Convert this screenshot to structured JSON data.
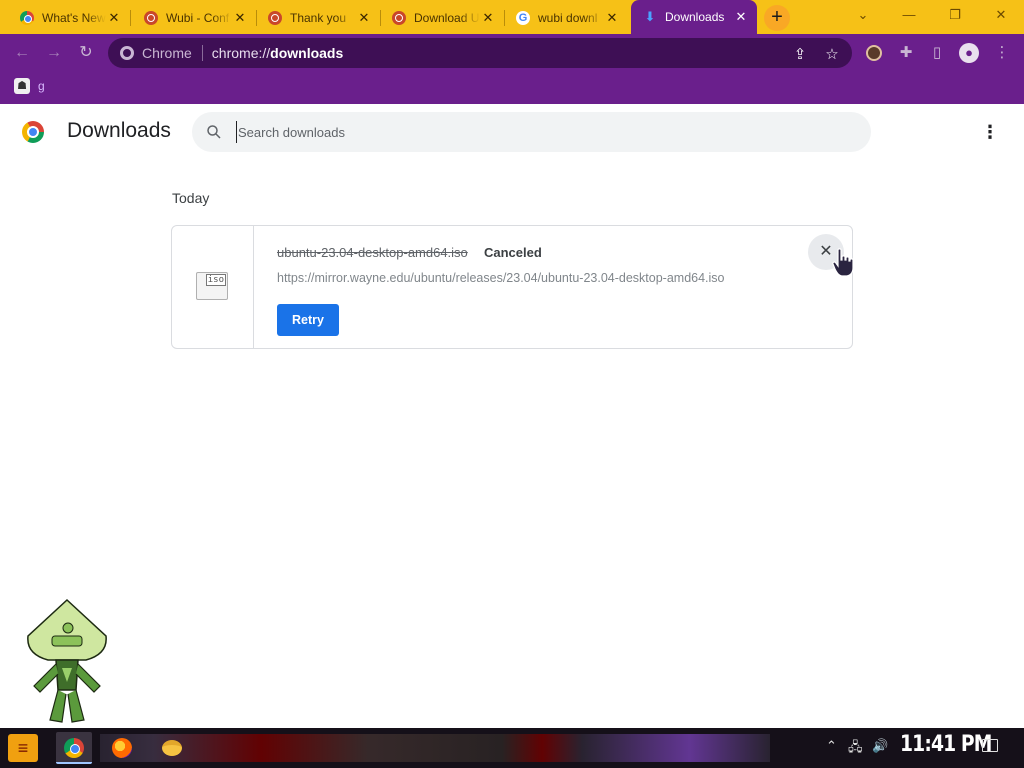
{
  "tabs": [
    {
      "label": "What's New",
      "favicon": "chrome-icon",
      "active": false
    },
    {
      "label": "Wubi - Conf",
      "favicon": "ubuntu-icon",
      "active": false
    },
    {
      "label": "Thank you",
      "favicon": "ubuntu-icon",
      "active": false
    },
    {
      "label": "Download Ub",
      "favicon": "ubuntu-icon",
      "active": false
    },
    {
      "label": "wubi downl",
      "favicon": "google-icon",
      "active": false
    },
    {
      "label": "Downloads",
      "favicon": "download-icon",
      "active": true
    }
  ],
  "omnibox": {
    "scheme_label": "Chrome",
    "url_prefix": "chrome://",
    "url_host": "downloads"
  },
  "bookmarks": [
    {
      "label": "g"
    }
  ],
  "downloads_page": {
    "title": "Downloads",
    "search_placeholder": "Search downloads",
    "section_label": "Today",
    "items": [
      {
        "file_name": "ubuntu-23.04-desktop-amd64.iso",
        "status": "Canceled",
        "url": "https://mirror.wayne.edu/ubuntu/releases/23.04/ubuntu-23.04-desktop-amd64.iso",
        "file_type_label": "iso",
        "retry_label": "Retry"
      }
    ]
  },
  "taskbar": {
    "clock": "11:41 PM"
  },
  "colors": {
    "tab_strip": "#f6c117",
    "browser_frame": "#6a1f8c",
    "accent_blue": "#1a73e8"
  }
}
